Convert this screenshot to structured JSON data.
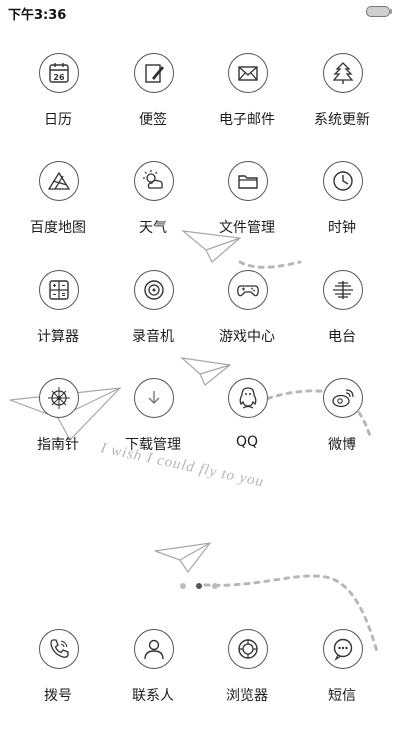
{
  "status_bar": {
    "time": "下午3:36"
  },
  "apps": [
    {
      "label": "日历",
      "icon": "calendar-icon",
      "day": "26"
    },
    {
      "label": "便签",
      "icon": "note-icon"
    },
    {
      "label": "电子邮件",
      "icon": "mail-icon"
    },
    {
      "label": "系统更新",
      "icon": "system-update-icon"
    },
    {
      "label": "百度地图",
      "icon": "map-icon"
    },
    {
      "label": "天气",
      "icon": "weather-icon"
    },
    {
      "label": "文件管理",
      "icon": "folder-icon"
    },
    {
      "label": "时钟",
      "icon": "clock-icon"
    },
    {
      "label": "计算器",
      "icon": "calculator-icon"
    },
    {
      "label": "录音机",
      "icon": "recorder-icon"
    },
    {
      "label": "游戏中心",
      "icon": "gamepad-icon"
    },
    {
      "label": "电台",
      "icon": "radio-icon"
    },
    {
      "label": "指南针",
      "icon": "compass-icon"
    },
    {
      "label": "下载管理",
      "icon": "download-icon"
    },
    {
      "label": "QQ",
      "icon": "qq-icon"
    },
    {
      "label": "微博",
      "icon": "weibo-icon"
    }
  ],
  "dock": [
    {
      "label": "拨号",
      "icon": "phone-icon"
    },
    {
      "label": "联系人",
      "icon": "contacts-icon"
    },
    {
      "label": "浏览器",
      "icon": "browser-icon"
    },
    {
      "label": "短信",
      "icon": "sms-icon"
    }
  ],
  "wallpaper": {
    "script_text": "I wish I could fly to you"
  },
  "page_indicator": {
    "pages": 3,
    "active": 2
  }
}
